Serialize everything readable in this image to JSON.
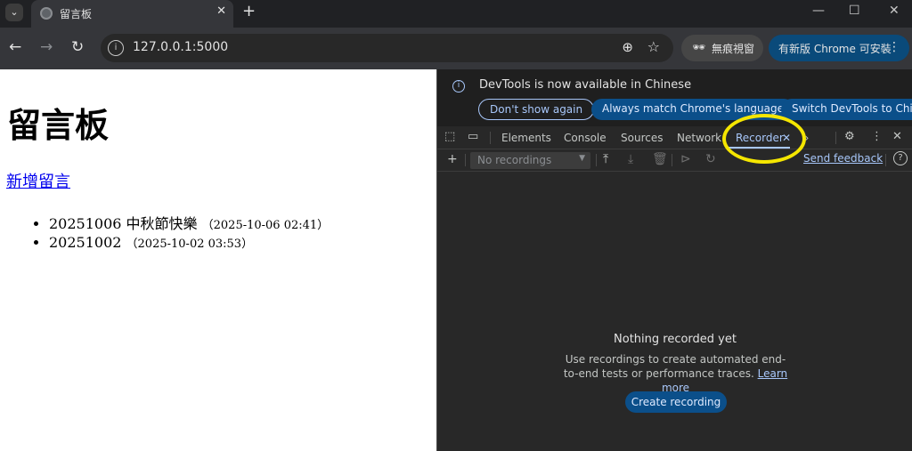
{
  "browser": {
    "tab_title": "留言板",
    "tab_close": "✕",
    "new_tab": "+",
    "url": "127.0.0.1:5000",
    "incognito_label": "無痕視窗",
    "update_label": "有新版 Chrome 可安裝",
    "window_controls": {
      "minimize": "—",
      "maximize": "☐",
      "close": "✕"
    }
  },
  "page": {
    "heading": "留言板",
    "new_post_link": "新增留言",
    "posts": [
      {
        "title": "20251006 中秋節快樂",
        "timestamp": "（2025-10-06 02:41）"
      },
      {
        "title": "20251002",
        "timestamp": "（2025-10-02 03:53）"
      }
    ]
  },
  "devtools": {
    "banner": {
      "message": "DevTools is now available in Chinese",
      "buttons": [
        "Don't show again",
        "Always match Chrome's language",
        "Switch DevTools to Chinese"
      ]
    },
    "tabs": [
      "Elements",
      "Console",
      "Sources",
      "Network",
      "Recorder"
    ],
    "active_tab": "Recorder",
    "tab_close": "✕",
    "more_tabs": "»",
    "recordings_select": "No recordings",
    "send_feedback": "Send feedback",
    "empty_title": "Nothing recorded yet",
    "empty_desc": "Use recordings to create automated end-to-end tests or performance traces.",
    "learn_more": "Learn more",
    "create_button": "Create recording"
  },
  "colors": {
    "highlight": "#f5e600",
    "accent": "#a8c7fa",
    "button_fill": "#0b4f8a"
  }
}
